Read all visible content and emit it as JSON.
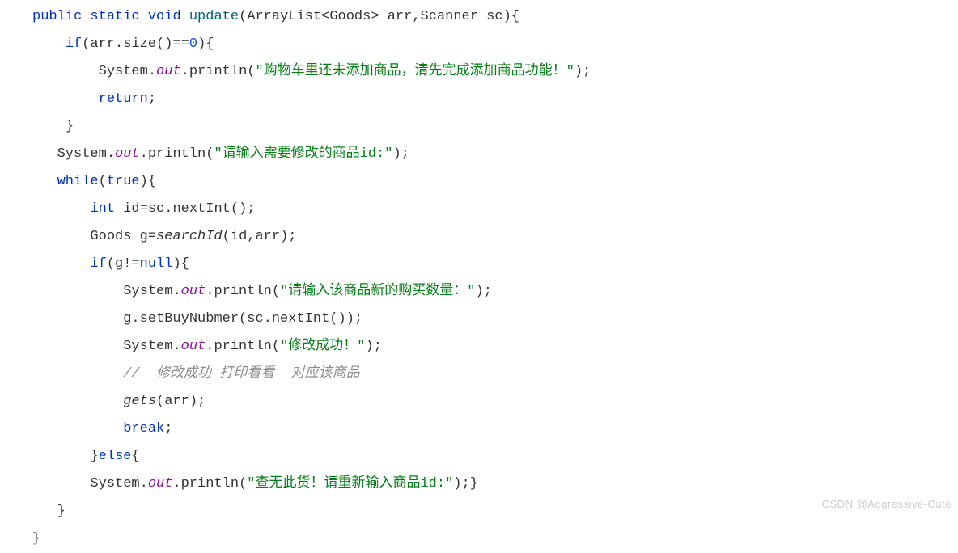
{
  "code": {
    "l1_kw1": "public",
    "l1_kw2": "static",
    "l1_kw3": "void",
    "l1_method": "update",
    "l1_paren_open": "(",
    "l1_type1": "ArrayList",
    "l1_lt": "<",
    "l1_type2": "Goods",
    "l1_gt": ">",
    "l1_arr": " arr",
    "l1_comma": ",",
    "l1_type3": "Scanner",
    "l1_sc": " sc",
    "l1_paren_close": ")",
    "l1_brace": "{",
    "l2_kw": "if",
    "l2_cond_open": "(",
    "l2_arr": "arr",
    "l2_dot1": ".",
    "l2_size": "size",
    "l2_parens": "()",
    "l2_eq": "==",
    "l2_zero": "0",
    "l2_cond_close": ")",
    "l2_brace": "{",
    "l3_sys": "System",
    "l3_dot1": ".",
    "l3_out": "out",
    "l3_dot2": ".",
    "l3_println": "println",
    "l3_open": "(",
    "l3_str": "\"购物车里还未添加商品，清先完成添加商品功能！\"",
    "l3_close": ")",
    "l3_semi": ";",
    "l4_kw": "return",
    "l4_semi": ";",
    "l5_brace": "}",
    "l6_sys": "System",
    "l6_dot1": ".",
    "l6_out": "out",
    "l6_dot2": ".",
    "l6_println": "println",
    "l6_open": "(",
    "l6_str": "\"请输入需要修改的商品id:\"",
    "l6_close": ")",
    "l6_semi": ";",
    "l7_kw": "while",
    "l7_open": "(",
    "l7_true": "true",
    "l7_close": ")",
    "l7_brace": "{",
    "l8_kw": "int",
    "l8_id": " id",
    "l8_eq": "=",
    "l8_sc": "sc",
    "l8_dot": ".",
    "l8_nextint": "nextInt",
    "l8_parens": "()",
    "l8_semi": ";",
    "l9_type": "Goods",
    "l9_g": " g",
    "l9_eq": "=",
    "l9_search": "searchId",
    "l9_open": "(",
    "l9_id": "id",
    "l9_comma": ",",
    "l9_arr": "arr",
    "l9_close": ")",
    "l9_semi": ";",
    "l10_kw": "if",
    "l10_open": "(",
    "l10_g": "g",
    "l10_neq": "!=",
    "l10_null": "null",
    "l10_close": ")",
    "l10_brace": "{",
    "l11_sys": "System",
    "l11_dot1": ".",
    "l11_out": "out",
    "l11_dot2": ".",
    "l11_println": "println",
    "l11_open": "(",
    "l11_str": "\"请输入该商品新的购买数量：\"",
    "l11_close": ")",
    "l11_semi": ";",
    "l12_g": "g",
    "l12_dot": ".",
    "l12_setbuy": "setBuyNubmer",
    "l12_open": "(",
    "l12_sc": "sc",
    "l12_dot2": ".",
    "l12_nextint": "nextInt",
    "l12_parens": "()",
    "l12_close": ")",
    "l12_semi": ";",
    "l13_sys": "System",
    "l13_dot1": ".",
    "l13_out": "out",
    "l13_dot2": ".",
    "l13_println": "println",
    "l13_open": "(",
    "l13_str": "\"修改成功！\"",
    "l13_close": ")",
    "l13_semi": ";",
    "l14_comment": "//  修改成功 打印看看  对应该商品",
    "l15_gets": "gets",
    "l15_open": "(",
    "l15_arr": "arr",
    "l15_close": ")",
    "l15_semi": ";",
    "l16_kw": "break",
    "l16_semi": ";",
    "l17_brace": "}",
    "l17_kw": "else",
    "l17_brace2": "{",
    "l18_sys": "System",
    "l18_dot1": ".",
    "l18_out": "out",
    "l18_dot2": ".",
    "l18_println": "println",
    "l18_open": "(",
    "l18_str": "\"查无此货！请重新输入商品id:\"",
    "l18_close": ")",
    "l18_semi": ";",
    "l18_brace": "}",
    "l19_brace": "}",
    "l20_brace": "}"
  },
  "watermark": "CSDN @Aggressive-Cute"
}
